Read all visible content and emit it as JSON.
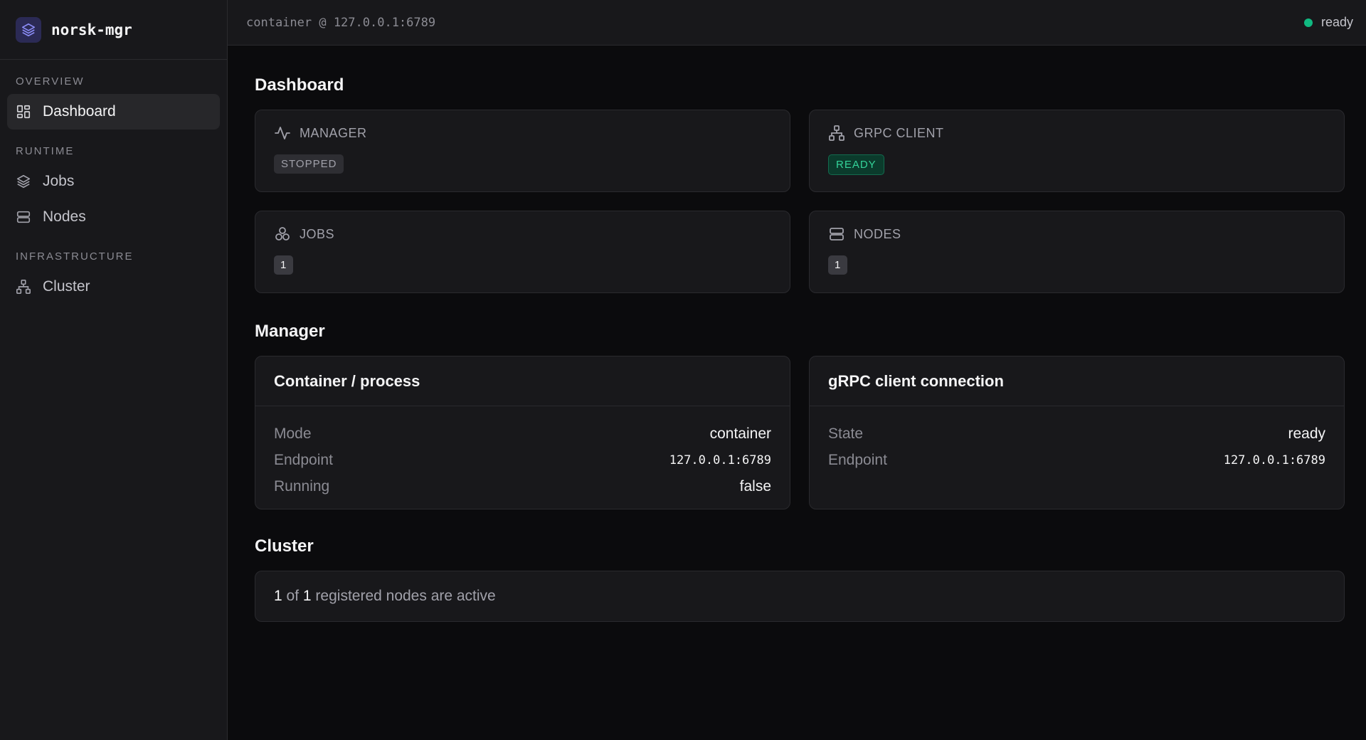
{
  "brand": {
    "name": "norsk-mgr",
    "icon": "layers-icon"
  },
  "sidebar": {
    "sections": [
      {
        "title": "OVERVIEW",
        "items": [
          {
            "label": "Dashboard",
            "icon": "dashboard-icon",
            "active": true
          }
        ]
      },
      {
        "title": "RUNTIME",
        "items": [
          {
            "label": "Jobs",
            "icon": "layers-icon"
          },
          {
            "label": "Nodes",
            "icon": "server-icon"
          }
        ]
      },
      {
        "title": "INFRASTRUCTURE",
        "items": [
          {
            "label": "Cluster",
            "icon": "network-icon"
          }
        ]
      }
    ]
  },
  "topbar": {
    "context": "container @ 127.0.0.1:6789",
    "status": "ready",
    "status_color": "#10b981"
  },
  "dashboard": {
    "title": "Dashboard",
    "cards": {
      "manager": {
        "label": "MANAGER",
        "icon": "activity-icon",
        "badge": "STOPPED"
      },
      "grpc": {
        "label": "GRPC CLIENT",
        "icon": "network-icon",
        "badge": "READY"
      },
      "jobs": {
        "label": "JOBS",
        "icon": "boxes-icon",
        "count": "1"
      },
      "nodes": {
        "label": "NODES",
        "icon": "server-icon",
        "count": "1"
      }
    }
  },
  "manager": {
    "title": "Manager",
    "container": {
      "title": "Container / process",
      "mode_label": "Mode",
      "mode": "container",
      "endpoint_label": "Endpoint",
      "endpoint": "127.0.0.1:6789",
      "running_label": "Running",
      "running": "false"
    },
    "grpc": {
      "title": "gRPC client connection",
      "state_label": "State",
      "state": "ready",
      "endpoint_label": "Endpoint",
      "endpoint": "127.0.0.1:6789"
    }
  },
  "cluster": {
    "title": "Cluster",
    "active": "1",
    "of": "of",
    "total": "1",
    "suffix": "registered nodes are active"
  },
  "colors": {
    "accent": "#2b2a55",
    "ready": "#34d399",
    "bg": "#0b0b0d",
    "panel": "#18181b"
  }
}
